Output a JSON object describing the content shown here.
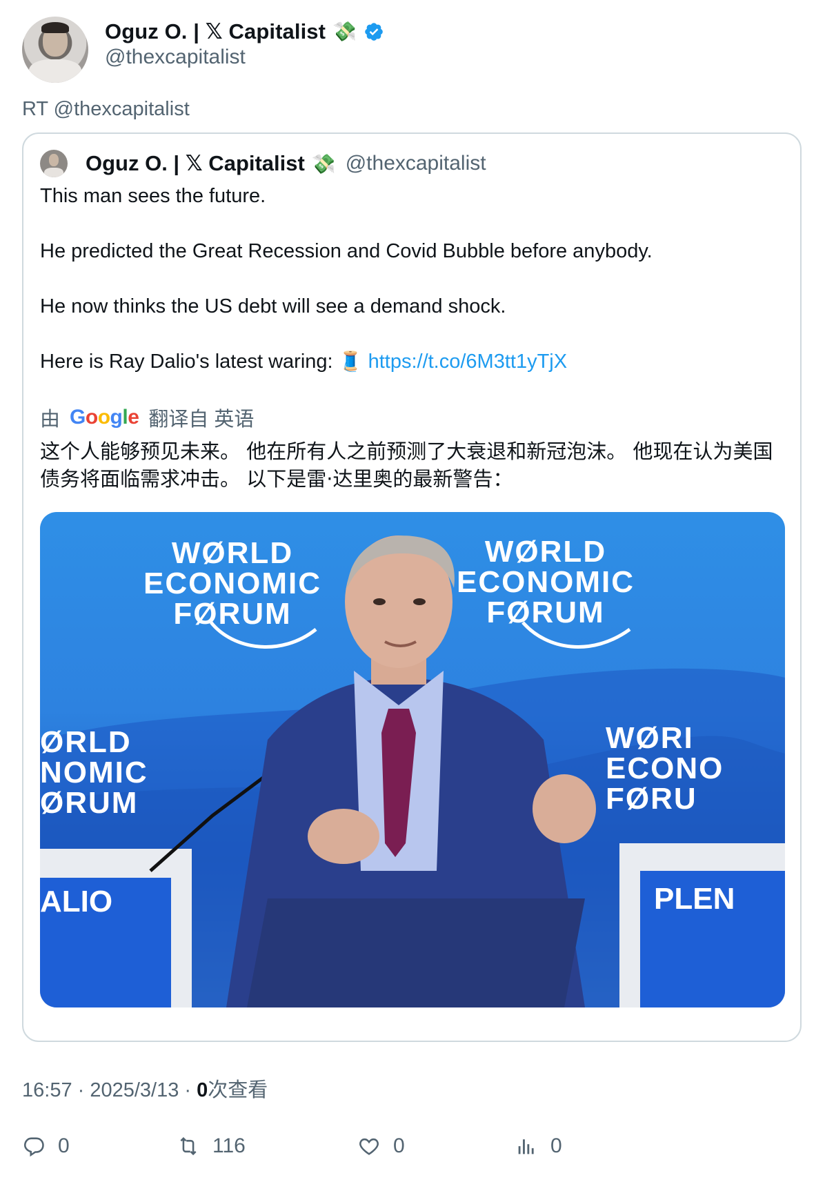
{
  "tweet": {
    "author_name": "Oguz O. | 𝕏 Capitalist",
    "author_handle": "@thexcapitalist",
    "name_emoji": "💸",
    "retweet_label": "RT @thexcapitalist"
  },
  "quoted": {
    "author_name": "Oguz O. | 𝕏 Capitalist",
    "author_handle": "@thexcapitalist",
    "name_emoji": "💸",
    "lines": [
      "This man sees the future.",
      "He predicted the Great Recession and Covid Bubble before anybody.",
      "He now thinks the US debt will see a demand shock."
    ],
    "last_line_text": "Here is Ray Dalio's latest waring: ",
    "thread_emoji": "🧵",
    "link": "https://t.co/6M3tt1yTjX",
    "translate_prefix": "由",
    "translate_suffix": "翻译自 英语",
    "translated_text": "这个人能够预见未来。 他在所有人之前预测了大衰退和新冠泡沫。 他现在认为美国债务将面临需求冲击。 以下是雷·达里奥的最新警告：",
    "photo": {
      "wef_line1": "WØRLD",
      "wef_line2": "ECONOMIC",
      "wef_line3": "FØRUM",
      "left_line1": "ØRLD",
      "left_line2": "NOMIC",
      "left_line3": "ØRUM",
      "right_line1": "WØRI",
      "right_line2": "ECONO",
      "right_line3": "FØRU",
      "plate_left": "ALIO",
      "plate_right": "PLEN"
    }
  },
  "meta": {
    "time": "16:57 · 2025/3/13 · ",
    "views_count": "0",
    "views_label": "次查看"
  },
  "actions": {
    "reply_count": "0",
    "retweet_count": "116",
    "like_count": "0",
    "views_count": "0"
  },
  "colors": {
    "link": "#1d9bf0",
    "secondary_text": "#536471",
    "verified": "#1d9bf0",
    "border": "#cfd9de"
  }
}
